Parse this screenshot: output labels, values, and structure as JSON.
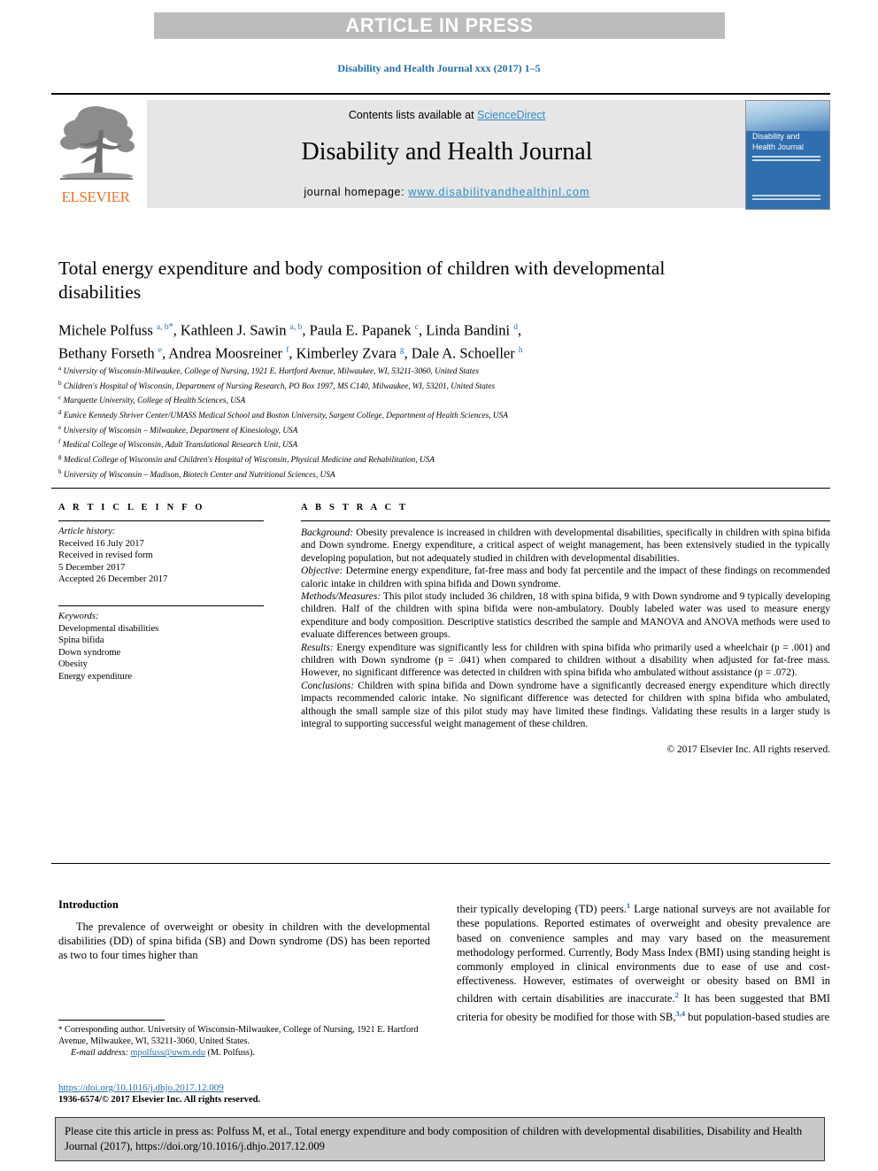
{
  "banner": {
    "label": "ARTICLE IN PRESS"
  },
  "citation_line": "Disability and Health Journal xxx (2017) 1–5",
  "masthead": {
    "contents_prefix": "Contents lists available at ",
    "sciencedirect": "ScienceDirect",
    "journal_title": "Disability and Health Journal",
    "homepage_prefix": "journal homepage: ",
    "homepage_url": "www.disabilityandhealthjnl.com",
    "publisher": "ELSEVIER",
    "cover_title": "Disability and Health Journal",
    "accent_blue": "#1f6fad",
    "link_blue": "#2b8cc4",
    "elsevier_orange": "#e87722",
    "cover_blue": "#2f6fae",
    "banner_gray": "#bcbcbc"
  },
  "article": {
    "title": "Total energy expenditure and body composition of children with developmental disabilities",
    "authors_line1_a": "Michele Polfuss ",
    "authors_line1_a_sup": "a, b",
    "authors_line1_b": ", Kathleen J. Sawin ",
    "authors_line1_b_sup": "a, b",
    "authors_line1_c": ", Paula E. Papanek ",
    "authors_line1_c_sup": "c",
    "authors_line1_d": ", Linda Bandini ",
    "authors_line1_d_sup": "d",
    "authors_line2_a": "Bethany Forseth ",
    "authors_line2_a_sup": "e",
    "authors_line2_b": ", Andrea Moosreiner ",
    "authors_line2_b_sup": "f",
    "authors_line2_c": ", Kimberley Zvara ",
    "authors_line2_c_sup": "g",
    "authors_line2_d": ", Dale A. Schoeller ",
    "authors_line2_d_sup": "h",
    "affiliations": [
      {
        "marker": "a",
        "text": "University of Wisconsin-Milwaukee, College of Nursing, 1921 E. Hartford Avenue, Milwaukee, WI, 53211-3060, United States"
      },
      {
        "marker": "b",
        "text": "Children's Hospital of Wisconsin, Department of Nursing Research, PO Box 1997, MS C140, Milwaukee, WI, 53201, United States"
      },
      {
        "marker": "c",
        "text": "Marquette University, College of Health Sciences, USA"
      },
      {
        "marker": "d",
        "text": "Eunice Kennedy Shriver Center/UMASS Medical School and Boston University, Sargent College, Department of Health Sciences, USA"
      },
      {
        "marker": "e",
        "text": "University of Wisconsin – Milwaukee, Department of Kinesiology, USA"
      },
      {
        "marker": "f",
        "text": "Medical College of Wisconsin, Adult Translational Research Unit, USA"
      },
      {
        "marker": "g",
        "text": "Medical College of Wisconsin and Children's Hospital of Wisconsin, Physical Medicine and Rehabilitation, USA"
      },
      {
        "marker": "h",
        "text": "University of Wisconsin – Madison, Biotech Center and Nutritional Sciences, USA"
      }
    ]
  },
  "article_info": {
    "heading": "A R T I C L E  I N F O",
    "history_label": "Article history:",
    "received": "Received 16 July 2017",
    "revised_label": "Received in revised form",
    "revised_date": "5 December 2017",
    "accepted": "Accepted 26 December 2017",
    "keywords_label": "Keywords:",
    "keywords": [
      "Developmental disabilities",
      "Spina bifida",
      "Down syndrome",
      "Obesity",
      "Energy expenditure"
    ]
  },
  "abstract": {
    "heading": "A B S T R A C T",
    "sections": [
      {
        "lead": "Background:",
        "text": " Obesity prevalence is increased in children with developmental disabilities, specifically in children with spina bifida and Down syndrome. Energy expenditure, a critical aspect of weight management, has been extensively studied in the typically developing population, but not adequately studied in children with developmental disabilities."
      },
      {
        "lead": "Objective:",
        "text": " Determine energy expenditure, fat-free mass and body fat percentile and the impact of these findings on recommended caloric intake in children with spina bifida and Down syndrome."
      },
      {
        "lead": "Methods/Measures:",
        "text": " This pilot study included 36 children, 18 with spina bifida, 9 with Down syndrome and 9 typically developing children. Half of the children with spina bifida were non-ambulatory. Doubly labeled water was used to measure energy expenditure and body composition. Descriptive statistics described the sample and MANOVA and ANOVA methods were used to evaluate differences between groups."
      },
      {
        "lead": "Results:",
        "text": " Energy expenditure was significantly less for children with spina bifida who primarily used a wheelchair (p = .001) and children with Down syndrome (p = .041) when compared to children without a disability when adjusted for fat-free mass. However, no significant difference was detected in children with spina bifida who ambulated without assistance (p = .072)."
      },
      {
        "lead": "Conclusions:",
        "text": " Children with spina bifida and Down syndrome have a significantly decreased energy expenditure which directly impacts recommended caloric intake. No significant difference was detected for children with spina bifida who ambulated, although the small sample size of this pilot study may have limited these findings. Validating these results in a larger study is integral to supporting successful weight management of these children."
      }
    ],
    "copyright": "© 2017 Elsevier Inc. All rights reserved."
  },
  "introduction": {
    "heading": "Introduction",
    "left_paragraph": "The prevalence of overweight or obesity in children with the developmental disabilities (DD) of spina bifida (SB) and Down syndrome (DS) has been reported as two to four times higher than",
    "right_part1": "their typically developing (TD) peers.",
    "right_ref1": "1",
    "right_part2": " Large national surveys are not available for these populations. Reported estimates of overweight and obesity prevalence are based on convenience samples and may vary based on the measurement methodology performed. Currently, Body Mass Index (BMI) using standing height is commonly employed in clinical environments due to ease of use and cost-effectiveness. However, estimates of overweight or obesity based on BMI in children with certain disabilities are inaccurate.",
    "right_ref2": "2",
    "right_part3": " It has been suggested that BMI criteria for obesity be modified for those with SB,",
    "right_ref3": "3,4",
    "right_part4": " but population-based studies are"
  },
  "footnote": {
    "star": "*",
    "corresponding": " Corresponding author. University of Wisconsin-Milwaukee, College of Nursing, 1921 E. Hartford Avenue, Milwaukee, WI, 53211-3060, United States.",
    "email_label": "E-mail address:",
    "email": "mpolfuss@uwm.edu",
    "email_suffix": " (M. Polfuss)."
  },
  "doi_block": {
    "doi_url": "https://doi.org/10.1016/j.dhjo.2017.12.009",
    "issn_line": "1936-6574/© 2017 Elsevier Inc. All rights reserved."
  },
  "cite_box": {
    "text": "Please cite this article in press as: Polfuss M, et al., Total energy expenditure and body composition of children with developmental disabilities, Disability and Health Journal (2017), https://doi.org/10.1016/j.dhjo.2017.12.009"
  }
}
